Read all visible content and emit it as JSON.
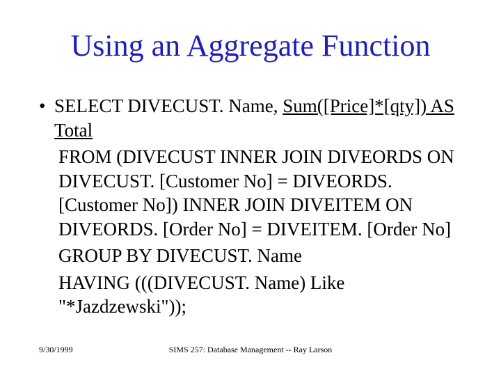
{
  "title": "Using an Aggregate Function",
  "bullet": {
    "line1_part1": "SELECT DIVECUST. Name, ",
    "line1_part2": "Sum([Price]*[qty]) AS Total",
    "from": "FROM (DIVECUST INNER JOIN DIVEORDS ON DIVECUST. [Customer No] = DIVEORDS. [Customer No]) INNER JOIN DIVEITEM ON DIVEORDS. [Order No] = DIVEITEM. [Order No]",
    "groupby": "GROUP BY DIVECUST. Name",
    "having": "HAVING (((DIVECUST. Name) Like \"*Jazdzewski\"));"
  },
  "footer": {
    "date": "9/30/1999",
    "course": "SIMS 257: Database Management -- Ray Larson"
  }
}
